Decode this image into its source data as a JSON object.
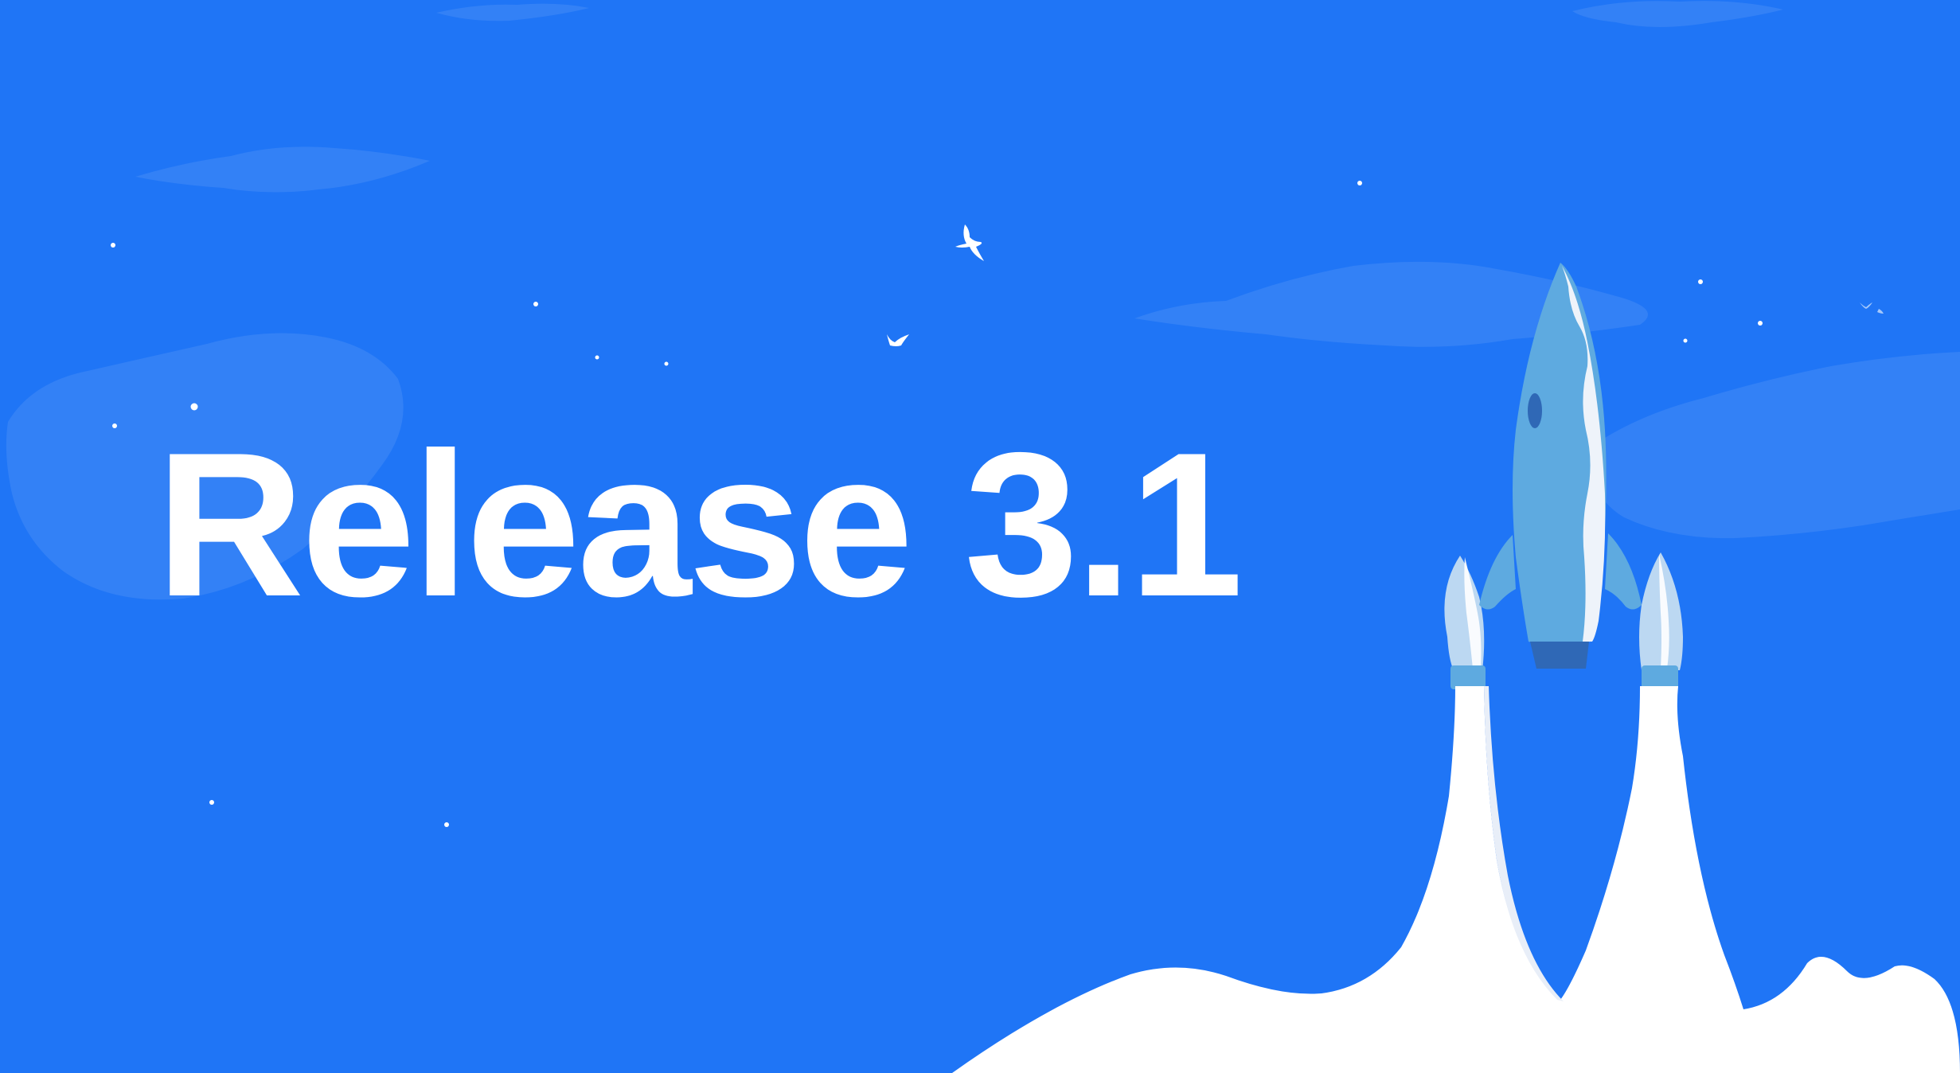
{
  "banner": {
    "headline": "Release 3.1"
  },
  "colors": {
    "sky": "#1f75f6",
    "cloud": "#4a8fe8",
    "rocket_body": "#5eaae0",
    "rocket_highlight": "#eef3fa",
    "rocket_window": "#2f68b6",
    "smoke": "#ffffff",
    "text": "#ffffff"
  },
  "icons": [
    "rocket-icon",
    "bird-icon",
    "star-icon",
    "cloud-shape",
    "smoke-plume"
  ]
}
